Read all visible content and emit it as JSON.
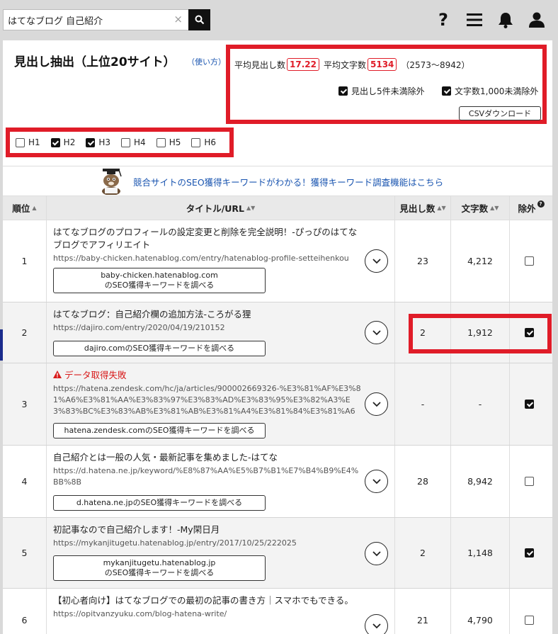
{
  "search": {
    "value": "はてなブログ 自己紹介",
    "clear": "×"
  },
  "header_icons": [
    "help-icon",
    "menu-icon",
    "bell-icon",
    "user-icon"
  ],
  "help_label": "?",
  "title": "見出し抽出（上位20サイト）",
  "howto": "（使い方）",
  "stats": {
    "avg_headings_label": "平均見出し数",
    "avg_headings": "17.22",
    "avg_chars_label": "平均文字数",
    "avg_chars": "5134",
    "range": "（2573〜8942）",
    "filter_headings": "見出し5件未満除外",
    "filter_chars": "文字数1,000未満除外",
    "csv": "CSVダウンロード"
  },
  "levels": [
    {
      "label": "H1",
      "checked": false
    },
    {
      "label": "H2",
      "checked": true
    },
    {
      "label": "H3",
      "checked": true
    },
    {
      "label": "H4",
      "checked": false
    },
    {
      "label": "H5",
      "checked": false
    },
    {
      "label": "H6",
      "checked": false
    }
  ],
  "promo": "競合サイトのSEO獲得キーワードがわかる！獲得キーワード調査機能はこちら",
  "columns": {
    "rank": "順位",
    "title": "タイトル/URL",
    "headings": "見出し数",
    "chars": "文字数",
    "exclude": "除外",
    "exclude_help": "?"
  },
  "sort_icon": "▲",
  "sort_both": "▲▼",
  "rows": [
    {
      "rank": "1",
      "title": "はてなブログのプロフィールの設定変更と削除を完全説明！-ぴっぴのはてなブログでアフィリエイト",
      "url": "https://baby-chicken.hatenablog.com/entry/hatenablog-profile-setteihenkou",
      "kw1": "baby-chicken.hatenablog.com",
      "kw2": "のSEO獲得キーワードを調べる",
      "headings": "23",
      "chars": "4,212",
      "excluded": false
    },
    {
      "rank": "2",
      "title": "はてなブログ：自己紹介欄の追加方法-ころがる狸",
      "url": "https://dajiro.com/entry/2020/04/19/210152",
      "kw1": "dajiro.comのSEO獲得キーワードを調べる",
      "kw2": "",
      "headings": "2",
      "chars": "1,912",
      "excluded": true
    },
    {
      "rank": "3",
      "title": "データ取得失敗",
      "url": "https://hatena.zendesk.com/hc/ja/articles/900002669326-%E3%81%AF%E3%81%A6%E3%81%AA%E3%83%97%E3%83%AD%E3%83%95%E3%82%A3%E3%83%BC%E3%83%AB%E3%81%AB%E3%81%A4%E3%81%84%E3%81%A6",
      "kw1": "hatena.zendesk.comのSEO獲得キーワードを調べる",
      "kw2": "",
      "headings": "-",
      "chars": "-",
      "excluded": true
    },
    {
      "rank": "4",
      "title": "自己紹介とは一般の人気・最新記事を集めました-はてな",
      "url": "https://d.hatena.ne.jp/keyword/%E8%87%AA%E5%B7%B1%E7%B4%B9%E4%BB%8B",
      "kw1": "d.hatena.ne.jpのSEO獲得キーワードを調べる",
      "kw2": "",
      "headings": "28",
      "chars": "8,942",
      "excluded": false
    },
    {
      "rank": "5",
      "title": "初記事なので自己紹介します！-My閑日月",
      "url": "https://mykanjitugetu.hatenablog.jp/entry/2017/10/25/222025",
      "kw1": "mykanjitugetu.hatenablog.jp",
      "kw2": "のSEO獲得キーワードを調べる",
      "headings": "2",
      "chars": "1,148",
      "excluded": true
    },
    {
      "rank": "6",
      "title": "【初心者向け】はてなブログでの最初の記事の書き方｜スマホでもできる。",
      "url": "https://opitvanzyuku.com/blog-hatena-write/",
      "kw1": "",
      "kw2": "",
      "headings": "21",
      "chars": "4,790",
      "excluded": false
    }
  ]
}
